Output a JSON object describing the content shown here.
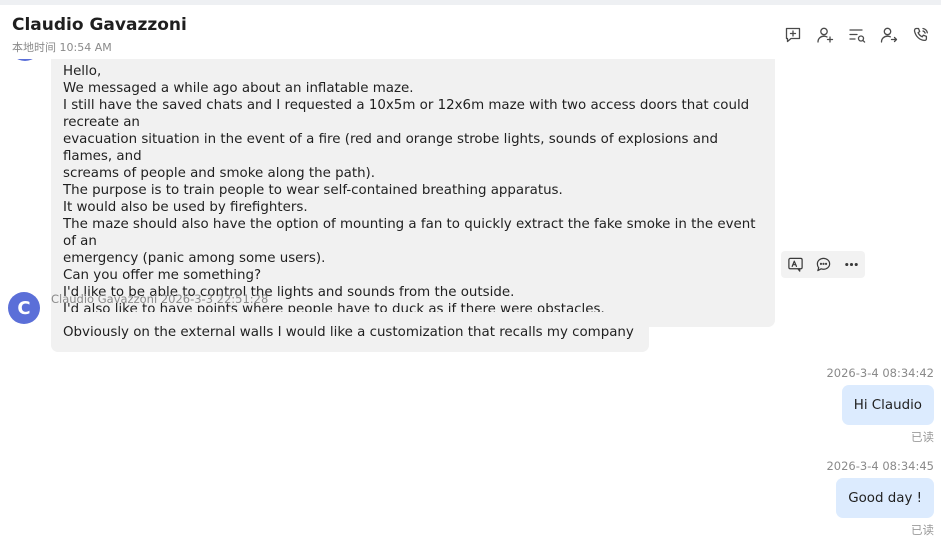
{
  "header": {
    "contact_name": "Claudio Gavazzoni",
    "local_time": "本地时间 10:54 AM",
    "icons": [
      "add-comment-icon",
      "contact-profile-icon",
      "search-messages-icon",
      "transfer-contact-icon",
      "phone-call-icon"
    ]
  },
  "messages": {
    "long_message": {
      "lines": [
        "Hello,",
        "We messaged a while ago about an inflatable maze.",
        "I still have the saved chats and I requested a 10x5m or 12x6m maze with two access doors that could recreate an",
        "evacuation situation in the event of a fire (red and orange strobe lights, sounds of explosions and flames, and",
        "screams of people and smoke along the path).",
        "The purpose is to train people to wear self-contained breathing apparatus.",
        "It would also be used by firefighters.",
        "The maze should also have the option of mounting a fan to quickly extract the fake smoke in the event of an",
        "emergency (panic among some users).",
        "Can you offer me something?",
        "I'd like to be able to control the lights and sounds from the outside.",
        "I'd also like to have points where people have to duck as if there were obstacles."
      ],
      "tools": [
        "translate-icon",
        "reply-icon",
        "more-icon"
      ]
    },
    "incoming": {
      "avatar_letter": "C",
      "sender": "Claudio Gavazzoni",
      "time": "2026-3-3 22:51:28",
      "text": "Obviously on the external walls I would like a customization that recalls my company"
    },
    "outgoing": [
      {
        "time": "2026-3-4 08:34:42",
        "text": "Hi Claudio",
        "status": "已读"
      },
      {
        "time": "2026-3-4 08:34:45",
        "text": "Good day !",
        "status": "已读"
      }
    ]
  },
  "colors": {
    "avatar": "#5b6fd8",
    "incoming_bubble": "#f1f1f1",
    "outgoing_bubble": "#dcebfe"
  }
}
